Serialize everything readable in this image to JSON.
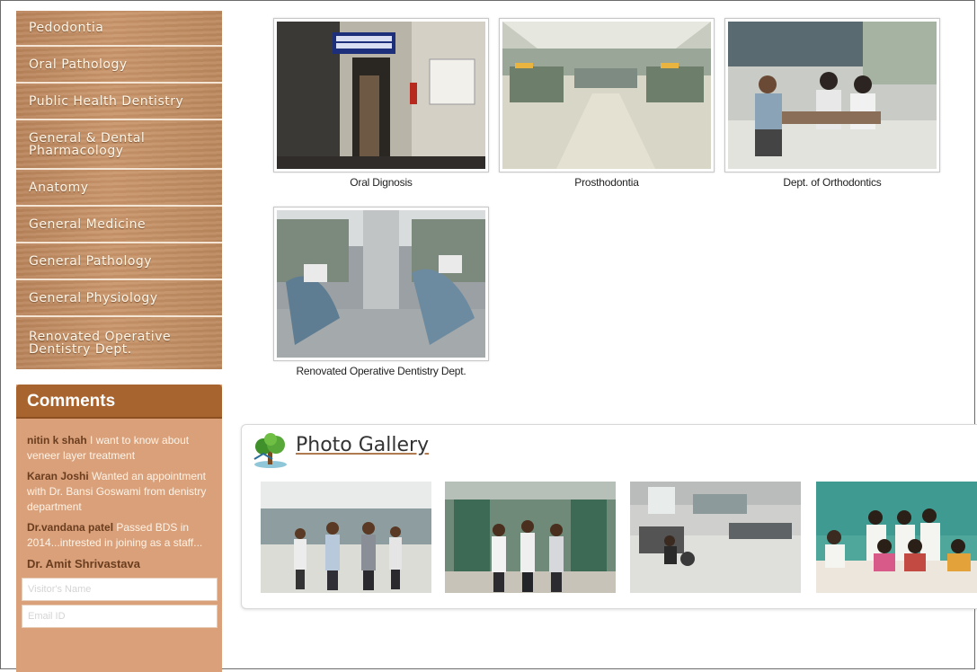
{
  "sidebar": {
    "items": [
      {
        "label": "Pedodontia"
      },
      {
        "label": "Oral Pathology"
      },
      {
        "label": "Public Health Dentistry"
      },
      {
        "label": "General & Dental Pharmacology"
      },
      {
        "label": "Anatomy"
      },
      {
        "label": "General Medicine"
      },
      {
        "label": "General Pathology"
      },
      {
        "label": "General Physiology"
      },
      {
        "label": "Renovated Operative Dentistry Dept."
      }
    ]
  },
  "comments": {
    "title": "Comments",
    "entries": [
      {
        "author": "nitin k shah",
        "text": " I want to know about veneer layer treatment"
      },
      {
        "author": "Karan Joshi",
        "text": " Wanted an appointment with Dr. Bansi Goswami from denistry department"
      },
      {
        "author": "Dr.vandana patel",
        "text": " Passed BDS in 2014...intrested in joining as a staff..."
      },
      {
        "author": "Dr. Amit Shrivastava",
        "text": ""
      }
    ],
    "name_placeholder": "Visitor's Name",
    "email_placeholder": "Email ID"
  },
  "departments": [
    {
      "caption": "Oral Dignosis"
    },
    {
      "caption": "Prosthodontia"
    },
    {
      "caption": "Dept. of Orthodontics"
    },
    {
      "caption": "Renovated Operative Dentistry Dept."
    }
  ],
  "gallery": {
    "title": "Photo Gallery",
    "icon": "tree-globe-icon"
  },
  "colors": {
    "menu_wood": "#c08a60",
    "comments_header": "#a8642f",
    "comments_body": "#d9a07a",
    "author": "#6a3d1f"
  }
}
